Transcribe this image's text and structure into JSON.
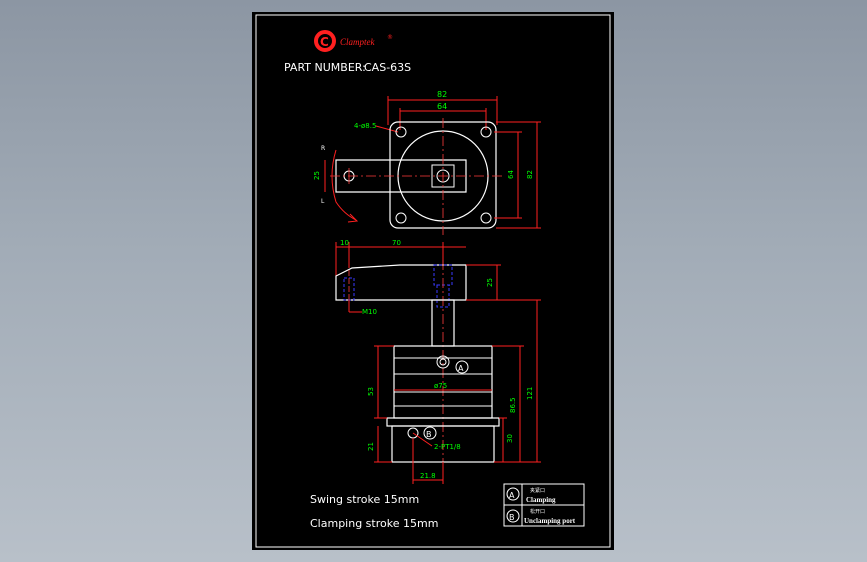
{
  "brand": {
    "name": "Clamptek",
    "mark": "C",
    "registered": "®"
  },
  "title": {
    "label": "PART NUMBER:",
    "value": "CAS-63S"
  },
  "dims": {
    "d82_top": "82",
    "d64_top": "64",
    "holes": "4-ø8.5",
    "d25_arm": "25",
    "d64_right": "64",
    "d82_right": "82",
    "d10": "10",
    "d70": "70",
    "d25_side": "25",
    "thread": "M10",
    "d53": "53",
    "dia75": "ø75",
    "d21": "21",
    "d86_5": "86.5",
    "d121": "121",
    "d30": "30",
    "d21_8": "21.8",
    "port_thread": "2-PT1/8",
    "rotation_r": "R",
    "rotation_l": "L"
  },
  "ports": {
    "a": "A",
    "b": "B"
  },
  "strokes": {
    "swing": "Swing stroke 15mm",
    "clamping": "Clamping stroke 15mm"
  },
  "legend": {
    "a_label": "A",
    "a_cn": "夹紧口",
    "a_text": "Clamping",
    "b_label": "B",
    "b_cn": "松开口",
    "b_text": "Unclamping port"
  },
  "colors": {
    "background": "#000000",
    "frame": "#ffffff",
    "outline": "#ffffff",
    "dimension": "#ff0000",
    "dim_text": "#00ff00",
    "center": "#ff3b3b",
    "hidden": "#3a3aff",
    "brand": "#ff2020"
  }
}
